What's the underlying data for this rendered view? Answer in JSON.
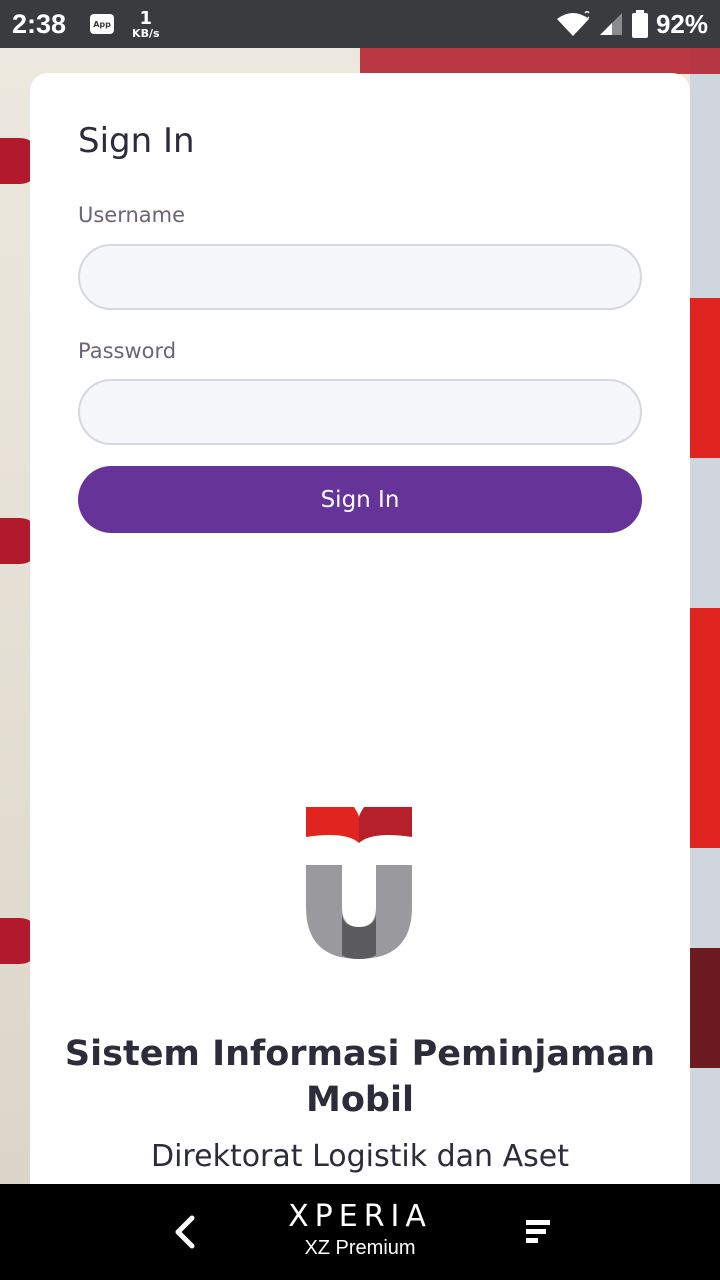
{
  "status_bar": {
    "time": "2:38",
    "app_badge": "App",
    "net_speed_value": "1",
    "net_speed_unit": "KB/s",
    "battery_percent": "92%"
  },
  "form": {
    "title": "Sign In",
    "username_label": "Username",
    "username_value": "",
    "password_label": "Password",
    "password_value": "",
    "submit_label": "Sign In"
  },
  "branding": {
    "app_title_line1": "Sistem Informasi Peminjaman",
    "app_title_line2": "Mobil",
    "subtitle": "Direktorat Logistik dan Aset"
  },
  "nav_bar": {
    "brand": "XPERIA",
    "model": "XZ Premium"
  },
  "colors": {
    "primary": "#663399",
    "logo_red": "#e0241f",
    "logo_gray": "#9a9a9e"
  }
}
